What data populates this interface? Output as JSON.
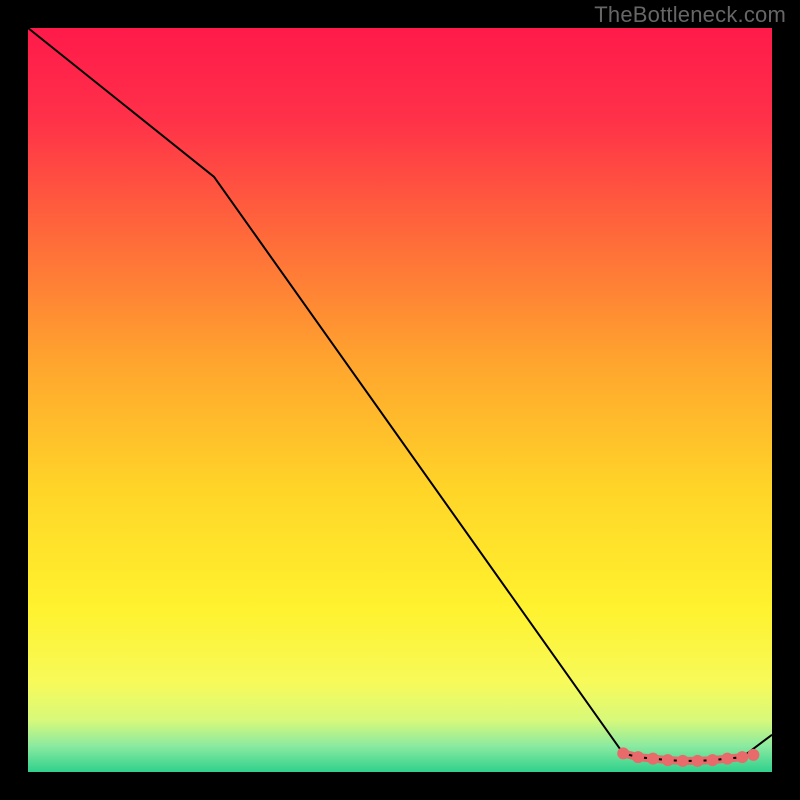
{
  "watermark": "TheBottleneck.com",
  "chart_data": {
    "type": "line",
    "title": "",
    "xlabel": "",
    "ylabel": "",
    "xlim": [
      0,
      100
    ],
    "ylim": [
      0,
      100
    ],
    "x": [
      0,
      25,
      80,
      82,
      84,
      86,
      88,
      90,
      92,
      94,
      96,
      100
    ],
    "values": [
      100,
      80,
      2.5,
      2.0,
      1.8,
      1.6,
      1.5,
      1.5,
      1.6,
      1.8,
      2.0,
      5
    ],
    "marker_points": {
      "x": [
        80,
        82,
        84,
        86,
        88,
        90,
        92,
        94,
        96
      ],
      "values": [
        2.5,
        2.0,
        1.8,
        1.6,
        1.5,
        1.5,
        1.6,
        1.8,
        2.0
      ]
    },
    "gradient_stops": [
      {
        "offset": 0.0,
        "color": "#ff1a4a"
      },
      {
        "offset": 0.12,
        "color": "#ff3049"
      },
      {
        "offset": 0.28,
        "color": "#ff6a3a"
      },
      {
        "offset": 0.45,
        "color": "#ffa52e"
      },
      {
        "offset": 0.62,
        "color": "#ffd528"
      },
      {
        "offset": 0.78,
        "color": "#fff22e"
      },
      {
        "offset": 0.88,
        "color": "#f7fa5a"
      },
      {
        "offset": 0.93,
        "color": "#d8f97a"
      },
      {
        "offset": 0.965,
        "color": "#8beaa0"
      },
      {
        "offset": 1.0,
        "color": "#2fd18d"
      }
    ],
    "line_color": "#000000",
    "marker_color": "#e86a6a",
    "marker_radius": 6,
    "marker_stroke_width": 8
  }
}
